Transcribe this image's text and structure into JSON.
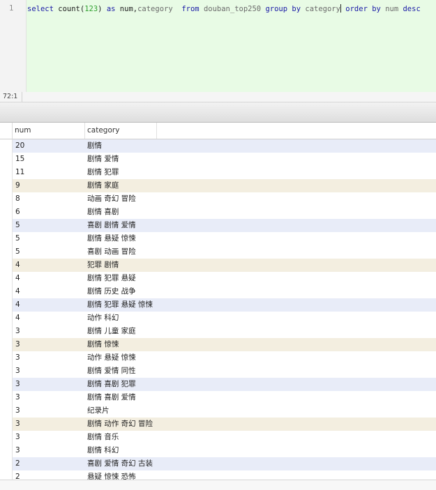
{
  "editor": {
    "line_number": "1",
    "sql_tokens": [
      {
        "text": "select",
        "kind": "kw"
      },
      {
        "text": " count(",
        "kind": "plain"
      },
      {
        "text": "123",
        "kind": "num"
      },
      {
        "text": ") ",
        "kind": "plain"
      },
      {
        "text": "as",
        "kind": "kw"
      },
      {
        "text": " num,",
        "kind": "plain"
      },
      {
        "text": "category",
        "kind": "id"
      },
      {
        "text": "  ",
        "kind": "plain"
      },
      {
        "text": "from",
        "kind": "kw"
      },
      {
        "text": " ",
        "kind": "plain"
      },
      {
        "text": "douban_top250",
        "kind": "id"
      },
      {
        "text": " ",
        "kind": "plain"
      },
      {
        "text": "group by",
        "kind": "kw"
      },
      {
        "text": " ",
        "kind": "plain"
      },
      {
        "text": "category",
        "kind": "id"
      },
      {
        "text": "|",
        "kind": "cursor"
      },
      {
        "text": " ",
        "kind": "plain"
      },
      {
        "text": "order by",
        "kind": "kw"
      },
      {
        "text": " ",
        "kind": "plain"
      },
      {
        "text": "num",
        "kind": "id"
      },
      {
        "text": " ",
        "kind": "plain"
      },
      {
        "text": "desc",
        "kind": "kw"
      }
    ],
    "colors": {
      "background": "#e8fbe5",
      "keyword": "#1a1aa6",
      "number": "#2e9f2e",
      "identifier": "#6b6b6b"
    }
  },
  "status_bar": {
    "cursor_position": "72:1"
  },
  "result_grid": {
    "columns": [
      "num",
      "category"
    ],
    "rows": [
      {
        "num": "20",
        "category": "剧情",
        "highlight": "#e8ecf8"
      },
      {
        "num": "15",
        "category": "剧情 爱情",
        "highlight": ""
      },
      {
        "num": "11",
        "category": "剧情 犯罪",
        "highlight": ""
      },
      {
        "num": "9",
        "category": "剧情 家庭",
        "highlight": "#f3eee0"
      },
      {
        "num": "8",
        "category": "动画 奇幻 冒险",
        "highlight": ""
      },
      {
        "num": "6",
        "category": "剧情 喜剧",
        "highlight": ""
      },
      {
        "num": "5",
        "category": "喜剧 剧情 爱情",
        "highlight": "#e8ecf8"
      },
      {
        "num": "5",
        "category": "剧情 悬疑 惊悚",
        "highlight": ""
      },
      {
        "num": "5",
        "category": "喜剧 动画 冒险",
        "highlight": ""
      },
      {
        "num": "4",
        "category": "犯罪 剧情",
        "highlight": "#f3eee0"
      },
      {
        "num": "4",
        "category": "剧情 犯罪 悬疑",
        "highlight": ""
      },
      {
        "num": "4",
        "category": "剧情 历史 战争",
        "highlight": ""
      },
      {
        "num": "4",
        "category": "剧情 犯罪 悬疑 惊悚",
        "highlight": "#e8ecf8"
      },
      {
        "num": "4",
        "category": "动作 科幻",
        "highlight": ""
      },
      {
        "num": "3",
        "category": "剧情 儿童 家庭",
        "highlight": ""
      },
      {
        "num": "3",
        "category": "剧情 惊悚",
        "highlight": "#f3eee0"
      },
      {
        "num": "3",
        "category": "动作 悬疑 惊悚",
        "highlight": ""
      },
      {
        "num": "3",
        "category": "剧情 爱情 同性",
        "highlight": ""
      },
      {
        "num": "3",
        "category": "剧情 喜剧 犯罪",
        "highlight": "#e8ecf8"
      },
      {
        "num": "3",
        "category": "剧情 喜剧 爱情",
        "highlight": ""
      },
      {
        "num": "3",
        "category": "纪录片",
        "highlight": ""
      },
      {
        "num": "3",
        "category": "剧情 动作 奇幻 冒险",
        "highlight": "#f3eee0"
      },
      {
        "num": "3",
        "category": "剧情 音乐",
        "highlight": ""
      },
      {
        "num": "3",
        "category": "剧情 科幻",
        "highlight": ""
      },
      {
        "num": "2",
        "category": "喜剧 爱情 奇幻 古装",
        "highlight": "#e8ecf8"
      },
      {
        "num": "2",
        "category": "悬疑 惊悚 恐怖",
        "highlight": ""
      }
    ]
  }
}
